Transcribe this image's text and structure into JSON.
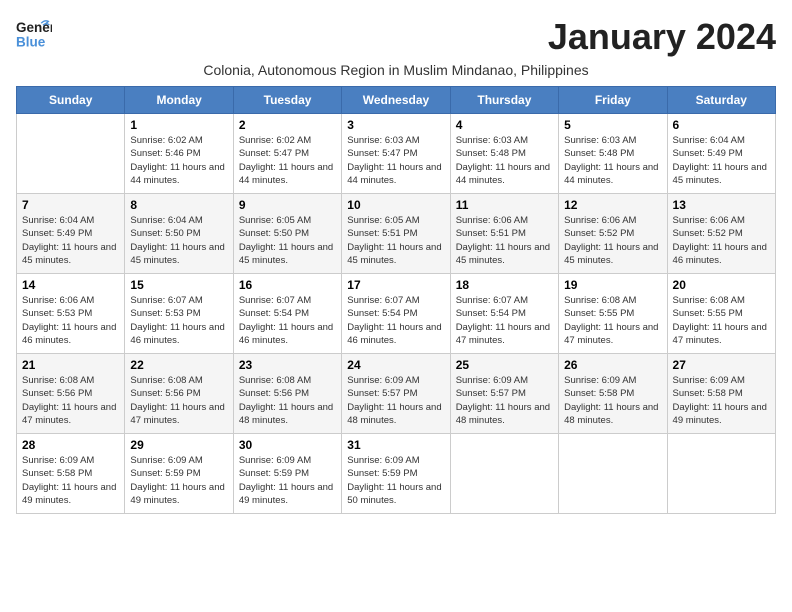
{
  "header": {
    "logo_general": "General",
    "logo_blue": "Blue",
    "month_title": "January 2024",
    "subtitle": "Colonia, Autonomous Region in Muslim Mindanao, Philippines"
  },
  "days_of_week": [
    "Sunday",
    "Monday",
    "Tuesday",
    "Wednesday",
    "Thursday",
    "Friday",
    "Saturday"
  ],
  "weeks": [
    [
      {
        "day": "",
        "sunrise": "",
        "sunset": "",
        "daylight": ""
      },
      {
        "day": "1",
        "sunrise": "Sunrise: 6:02 AM",
        "sunset": "Sunset: 5:46 PM",
        "daylight": "Daylight: 11 hours and 44 minutes."
      },
      {
        "day": "2",
        "sunrise": "Sunrise: 6:02 AM",
        "sunset": "Sunset: 5:47 PM",
        "daylight": "Daylight: 11 hours and 44 minutes."
      },
      {
        "day": "3",
        "sunrise": "Sunrise: 6:03 AM",
        "sunset": "Sunset: 5:47 PM",
        "daylight": "Daylight: 11 hours and 44 minutes."
      },
      {
        "day": "4",
        "sunrise": "Sunrise: 6:03 AM",
        "sunset": "Sunset: 5:48 PM",
        "daylight": "Daylight: 11 hours and 44 minutes."
      },
      {
        "day": "5",
        "sunrise": "Sunrise: 6:03 AM",
        "sunset": "Sunset: 5:48 PM",
        "daylight": "Daylight: 11 hours and 44 minutes."
      },
      {
        "day": "6",
        "sunrise": "Sunrise: 6:04 AM",
        "sunset": "Sunset: 5:49 PM",
        "daylight": "Daylight: 11 hours and 45 minutes."
      }
    ],
    [
      {
        "day": "7",
        "sunrise": "Sunrise: 6:04 AM",
        "sunset": "Sunset: 5:49 PM",
        "daylight": "Daylight: 11 hours and 45 minutes."
      },
      {
        "day": "8",
        "sunrise": "Sunrise: 6:04 AM",
        "sunset": "Sunset: 5:50 PM",
        "daylight": "Daylight: 11 hours and 45 minutes."
      },
      {
        "day": "9",
        "sunrise": "Sunrise: 6:05 AM",
        "sunset": "Sunset: 5:50 PM",
        "daylight": "Daylight: 11 hours and 45 minutes."
      },
      {
        "day": "10",
        "sunrise": "Sunrise: 6:05 AM",
        "sunset": "Sunset: 5:51 PM",
        "daylight": "Daylight: 11 hours and 45 minutes."
      },
      {
        "day": "11",
        "sunrise": "Sunrise: 6:06 AM",
        "sunset": "Sunset: 5:51 PM",
        "daylight": "Daylight: 11 hours and 45 minutes."
      },
      {
        "day": "12",
        "sunrise": "Sunrise: 6:06 AM",
        "sunset": "Sunset: 5:52 PM",
        "daylight": "Daylight: 11 hours and 45 minutes."
      },
      {
        "day": "13",
        "sunrise": "Sunrise: 6:06 AM",
        "sunset": "Sunset: 5:52 PM",
        "daylight": "Daylight: 11 hours and 46 minutes."
      }
    ],
    [
      {
        "day": "14",
        "sunrise": "Sunrise: 6:06 AM",
        "sunset": "Sunset: 5:53 PM",
        "daylight": "Daylight: 11 hours and 46 minutes."
      },
      {
        "day": "15",
        "sunrise": "Sunrise: 6:07 AM",
        "sunset": "Sunset: 5:53 PM",
        "daylight": "Daylight: 11 hours and 46 minutes."
      },
      {
        "day": "16",
        "sunrise": "Sunrise: 6:07 AM",
        "sunset": "Sunset: 5:54 PM",
        "daylight": "Daylight: 11 hours and 46 minutes."
      },
      {
        "day": "17",
        "sunrise": "Sunrise: 6:07 AM",
        "sunset": "Sunset: 5:54 PM",
        "daylight": "Daylight: 11 hours and 46 minutes."
      },
      {
        "day": "18",
        "sunrise": "Sunrise: 6:07 AM",
        "sunset": "Sunset: 5:54 PM",
        "daylight": "Daylight: 11 hours and 47 minutes."
      },
      {
        "day": "19",
        "sunrise": "Sunrise: 6:08 AM",
        "sunset": "Sunset: 5:55 PM",
        "daylight": "Daylight: 11 hours and 47 minutes."
      },
      {
        "day": "20",
        "sunrise": "Sunrise: 6:08 AM",
        "sunset": "Sunset: 5:55 PM",
        "daylight": "Daylight: 11 hours and 47 minutes."
      }
    ],
    [
      {
        "day": "21",
        "sunrise": "Sunrise: 6:08 AM",
        "sunset": "Sunset: 5:56 PM",
        "daylight": "Daylight: 11 hours and 47 minutes."
      },
      {
        "day": "22",
        "sunrise": "Sunrise: 6:08 AM",
        "sunset": "Sunset: 5:56 PM",
        "daylight": "Daylight: 11 hours and 47 minutes."
      },
      {
        "day": "23",
        "sunrise": "Sunrise: 6:08 AM",
        "sunset": "Sunset: 5:56 PM",
        "daylight": "Daylight: 11 hours and 48 minutes."
      },
      {
        "day": "24",
        "sunrise": "Sunrise: 6:09 AM",
        "sunset": "Sunset: 5:57 PM",
        "daylight": "Daylight: 11 hours and 48 minutes."
      },
      {
        "day": "25",
        "sunrise": "Sunrise: 6:09 AM",
        "sunset": "Sunset: 5:57 PM",
        "daylight": "Daylight: 11 hours and 48 minutes."
      },
      {
        "day": "26",
        "sunrise": "Sunrise: 6:09 AM",
        "sunset": "Sunset: 5:58 PM",
        "daylight": "Daylight: 11 hours and 48 minutes."
      },
      {
        "day": "27",
        "sunrise": "Sunrise: 6:09 AM",
        "sunset": "Sunset: 5:58 PM",
        "daylight": "Daylight: 11 hours and 49 minutes."
      }
    ],
    [
      {
        "day": "28",
        "sunrise": "Sunrise: 6:09 AM",
        "sunset": "Sunset: 5:58 PM",
        "daylight": "Daylight: 11 hours and 49 minutes."
      },
      {
        "day": "29",
        "sunrise": "Sunrise: 6:09 AM",
        "sunset": "Sunset: 5:59 PM",
        "daylight": "Daylight: 11 hours and 49 minutes."
      },
      {
        "day": "30",
        "sunrise": "Sunrise: 6:09 AM",
        "sunset": "Sunset: 5:59 PM",
        "daylight": "Daylight: 11 hours and 49 minutes."
      },
      {
        "day": "31",
        "sunrise": "Sunrise: 6:09 AM",
        "sunset": "Sunset: 5:59 PM",
        "daylight": "Daylight: 11 hours and 50 minutes."
      },
      {
        "day": "",
        "sunrise": "",
        "sunset": "",
        "daylight": ""
      },
      {
        "day": "",
        "sunrise": "",
        "sunset": "",
        "daylight": ""
      },
      {
        "day": "",
        "sunrise": "",
        "sunset": "",
        "daylight": ""
      }
    ]
  ]
}
